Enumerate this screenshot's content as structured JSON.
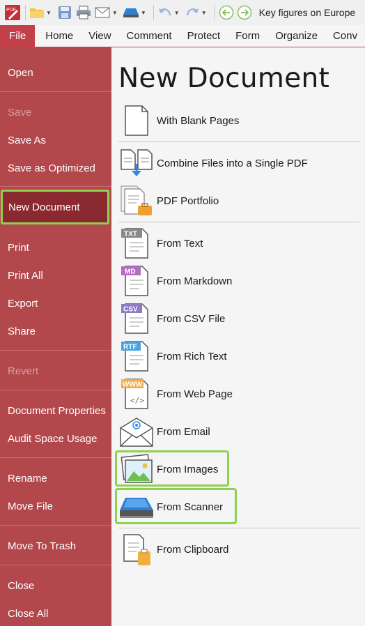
{
  "toolbar": {
    "app_icon": "pdf-app-icon",
    "doc_title": "Key figures on Europe",
    "icons": [
      "open-folder-icon",
      "save-icon",
      "print-icon",
      "email-icon",
      "scanner-icon",
      "undo-icon",
      "redo-icon",
      "back-icon",
      "forward-icon"
    ]
  },
  "tabs": [
    "File",
    "Home",
    "View",
    "Comment",
    "Protect",
    "Form",
    "Organize",
    "Conv"
  ],
  "menu": {
    "items": [
      {
        "label": "Open",
        "enabled": true
      },
      {
        "label": "Save",
        "enabled": false
      },
      {
        "label": "Save As",
        "enabled": true
      },
      {
        "label": "Save as Optimized",
        "enabled": true
      },
      {
        "label": "New Document",
        "enabled": true,
        "selected": true
      },
      {
        "label": "Print",
        "enabled": true
      },
      {
        "label": "Print All",
        "enabled": true
      },
      {
        "label": "Export",
        "enabled": true
      },
      {
        "label": "Share",
        "enabled": true
      },
      {
        "label": "Revert",
        "enabled": false
      },
      {
        "label": "Document Properties",
        "enabled": true
      },
      {
        "label": "Audit Space Usage",
        "enabled": true
      },
      {
        "label": "Rename",
        "enabled": true
      },
      {
        "label": "Move File",
        "enabled": true
      },
      {
        "label": "Move To Trash",
        "enabled": true
      },
      {
        "label": "Close",
        "enabled": true
      },
      {
        "label": "Close All",
        "enabled": true
      }
    ]
  },
  "panel": {
    "title": "New Document",
    "items": [
      {
        "label": "With Blank Pages",
        "icon": "blank-page-icon"
      },
      {
        "label": "Combine Files into a Single PDF",
        "icon": "combine-files-icon"
      },
      {
        "label": "PDF Portfolio",
        "icon": "portfolio-icon"
      },
      {
        "label": "From Text",
        "icon": "txt-file-icon",
        "badge": "TXT",
        "badge_color": "#8a8a8a"
      },
      {
        "label": "From Markdown",
        "icon": "md-file-icon",
        "badge": "MD",
        "badge_color": "#b36bc4"
      },
      {
        "label": "From CSV File",
        "icon": "csv-file-icon",
        "badge": "CSV",
        "badge_color": "#8f7bc4"
      },
      {
        "label": "From Rich Text",
        "icon": "rtf-file-icon",
        "badge": "RTF",
        "badge_color": "#4aa3e0"
      },
      {
        "label": "From Web Page",
        "icon": "www-file-icon",
        "badge": "WWW",
        "badge_color": "#f0b050"
      },
      {
        "label": "From Email",
        "icon": "email-file-icon"
      },
      {
        "label": "From Images",
        "icon": "image-file-icon",
        "highlighted": true
      },
      {
        "label": "From Scanner",
        "icon": "scanner-icon",
        "highlighted": true
      },
      {
        "label": "From Clipboard",
        "icon": "clipboard-icon"
      }
    ]
  },
  "colors": {
    "menu_bg": "#b2474c",
    "menu_selected": "#8a2a30",
    "highlight": "#8fd14f",
    "panel_bg": "#f5f5f5",
    "file_tab": "#c2404a"
  }
}
